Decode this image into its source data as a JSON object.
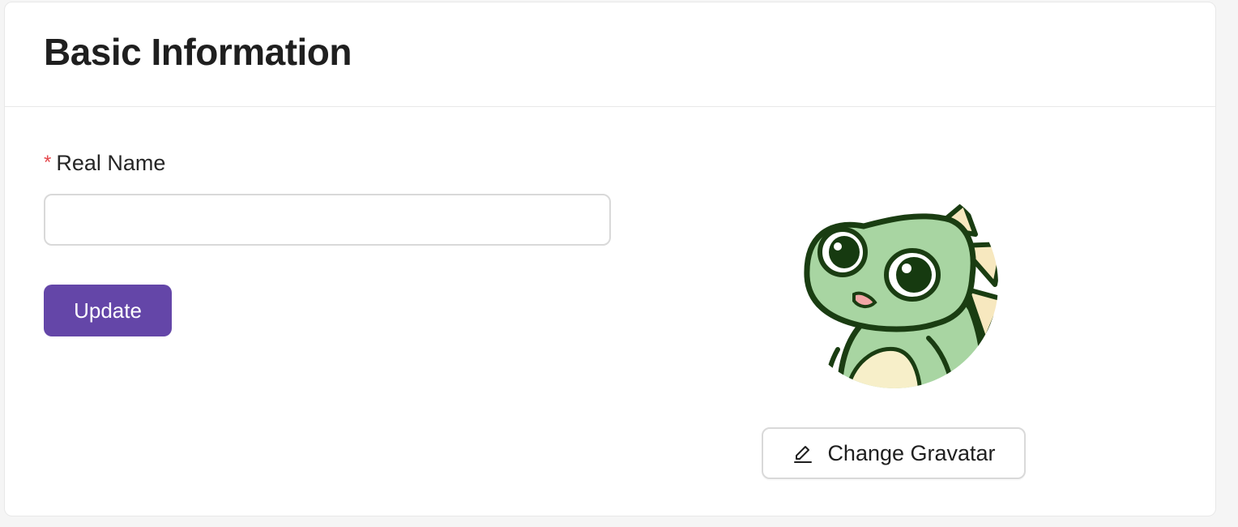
{
  "card": {
    "title": "Basic Information"
  },
  "form": {
    "required_mark": "*",
    "real_name_label": "Real Name",
    "real_name_value": "",
    "real_name_placeholder": "",
    "update_label": "Update"
  },
  "avatar": {
    "icon": "dinosaur-avatar",
    "change_label": "Change Gravatar",
    "change_icon": "edit-icon"
  },
  "colors": {
    "primary": "#6446a8",
    "required": "#e5484d",
    "avatar_green": "#a8d5a2",
    "avatar_outline": "#1a3d12",
    "avatar_spikes": "#f7e8bf"
  }
}
